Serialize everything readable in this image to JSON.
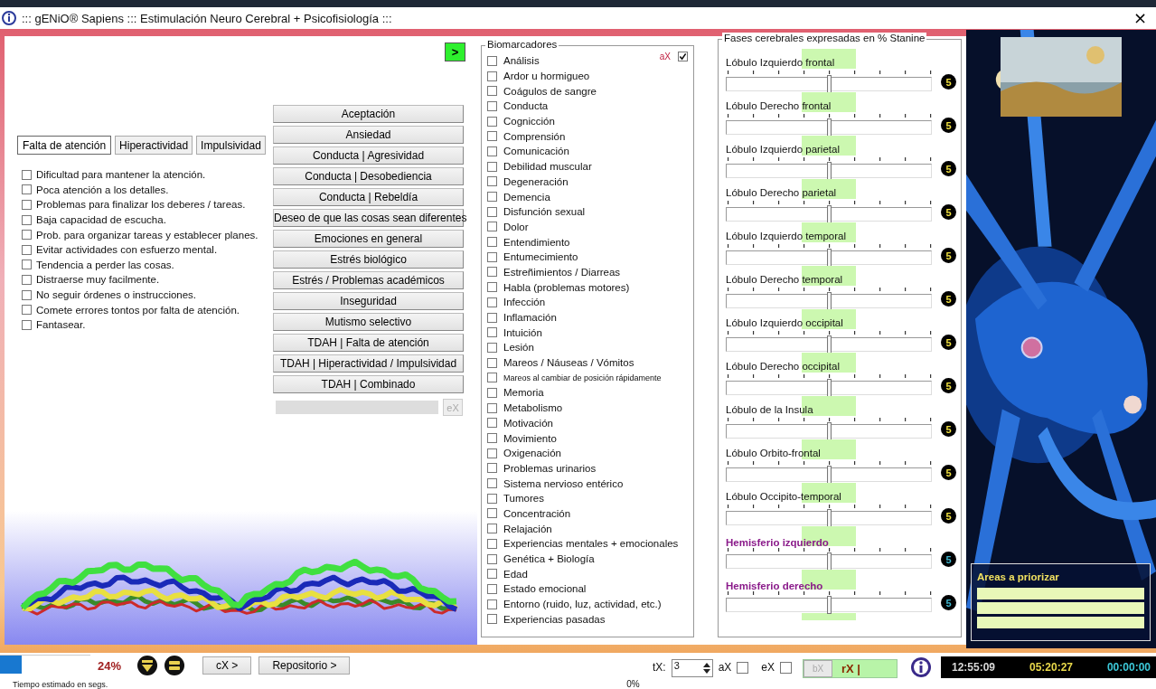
{
  "window": {
    "title": "::: gENiO® Sapiens ::: Estimulación Neuro Cerebral + Psicofisiología :::",
    "close": "×"
  },
  "next_button": ">",
  "tabs": [
    {
      "label": "Falta de atención",
      "selected": true
    },
    {
      "label": "Hiperactividad",
      "selected": false
    },
    {
      "label": "Impulsividad",
      "selected": false
    }
  ],
  "symptoms": [
    {
      "label": "Dificultad para mantener la atención.",
      "checked": false
    },
    {
      "label": "Poca atención a los detalles.",
      "checked": false
    },
    {
      "label": "Problemas para finalizar los deberes / tareas.",
      "checked": false
    },
    {
      "label": "Baja capacidad de escucha.",
      "checked": false
    },
    {
      "label": "Prob. para organizar tareas y establecer planes.",
      "checked": false
    },
    {
      "label": "Evitar actividades con esfuerzo mental.",
      "checked": false
    },
    {
      "label": "Tendencia a perder las cosas.",
      "checked": false
    },
    {
      "label": "Distraerse muy facilmente.",
      "checked": false
    },
    {
      "label": "No seguir órdenes o instrucciones.",
      "checked": false
    },
    {
      "label": "Comete errores tontos por falta de atención.",
      "checked": false
    },
    {
      "label": "Fantasear.",
      "checked": false
    }
  ],
  "protocol_buttons": [
    "Aceptación",
    "Ansiedad",
    "Conducta | Agresividad",
    "Conducta | Desobediencia",
    "Conducta | Rebeldía",
    "Deseo de que las cosas sean diferentes",
    "Emociones en general",
    "Estrés biológico",
    "Estrés / Problemas académicos",
    "Inseguridad",
    "Mutismo selectivo",
    "TDAH | Falta de atención",
    "TDAH | Hiperactividad / Impulsividad",
    "TDAH | Combinado"
  ],
  "ex_button": {
    "label": "eX",
    "disabled": true
  },
  "biomarkers": {
    "title": "Biomarcadores",
    "ax_label": "aX",
    "ax_checked": true,
    "items": [
      {
        "label": "Análisis",
        "kind": "normal",
        "checked": false
      },
      {
        "label": "Ardor u hormigueo",
        "kind": "normal",
        "checked": false
      },
      {
        "label": "Coágulos de sangre",
        "kind": "normal",
        "checked": false
      },
      {
        "label": "Conducta",
        "kind": "normal",
        "checked": false
      },
      {
        "label": "Cognicción",
        "kind": "normal",
        "checked": false
      },
      {
        "label": "Comprensión",
        "kind": "normal",
        "checked": false
      },
      {
        "label": "Comunicación",
        "kind": "normal",
        "checked": false
      },
      {
        "label": "Debilidad muscular",
        "kind": "normal",
        "checked": false
      },
      {
        "label": "Degeneración",
        "kind": "normal",
        "checked": false
      },
      {
        "label": "Demencia",
        "kind": "normal",
        "checked": false
      },
      {
        "label": "Disfunción sexual",
        "kind": "normal",
        "checked": false
      },
      {
        "label": "Dolor",
        "kind": "normal",
        "checked": false
      },
      {
        "label": "Entendimiento",
        "kind": "normal",
        "checked": false
      },
      {
        "label": "Entumecimiento",
        "kind": "normal",
        "checked": false
      },
      {
        "label": "Estreñimientos / Diarreas",
        "kind": "normal",
        "checked": false
      },
      {
        "label": "Habla (problemas motores)",
        "kind": "normal",
        "checked": false
      },
      {
        "label": "Infección",
        "kind": "normal",
        "checked": false
      },
      {
        "label": "Inflamación",
        "kind": "normal",
        "checked": false
      },
      {
        "label": "Intuición",
        "kind": "normal",
        "checked": false
      },
      {
        "label": "Lesión",
        "kind": "normal",
        "checked": false
      },
      {
        "label": "Mareos / Náuseas / Vómitos",
        "kind": "normal",
        "checked": false
      },
      {
        "label": "Mareos al cambiar de posición rápidamente",
        "kind": "small",
        "checked": false
      },
      {
        "label": "Memoria",
        "kind": "normal",
        "checked": false
      },
      {
        "label": "Metabolismo",
        "kind": "normal",
        "checked": false
      },
      {
        "label": "Motivación",
        "kind": "normal",
        "checked": false
      },
      {
        "label": "Movimiento",
        "kind": "normal",
        "checked": false
      },
      {
        "label": "Oxigenación",
        "kind": "normal",
        "checked": false
      },
      {
        "label": "Problemas urinarios",
        "kind": "normal",
        "checked": false
      },
      {
        "label": "Sistema nervioso entérico",
        "kind": "normal",
        "checked": false
      },
      {
        "label": "Tumores",
        "kind": "normal",
        "checked": false
      },
      {
        "label": "Concentración",
        "kind": "normal",
        "checked": false
      },
      {
        "label": "Relajación",
        "kind": "normal",
        "checked": false
      },
      {
        "label": "Experiencias mentales + emocionales",
        "kind": "normal",
        "checked": false
      },
      {
        "label": "Genética + Biología",
        "kind": "normal",
        "checked": false
      },
      {
        "label": "Edad",
        "kind": "normal",
        "checked": false
      },
      {
        "label": "Estado emocional",
        "kind": "normal",
        "checked": false
      },
      {
        "label": "Entorno (ruido, luz, actividad, etc.)",
        "kind": "normal",
        "checked": false
      },
      {
        "label": "Experiencias pasadas",
        "kind": "normal",
        "checked": false
      }
    ]
  },
  "phases": {
    "title": "Fases cerebrales expresadas en % Stanine",
    "sliders": [
      {
        "label": "Lóbulo Izquierdo frontal",
        "kind": "lobe",
        "level": 0.5,
        "value": "5"
      },
      {
        "label": "Lóbulo Derecho frontal",
        "kind": "lobe",
        "level": 0.5,
        "value": "5"
      },
      {
        "label": "Lóbulo Izquierdo parietal",
        "kind": "lobe",
        "level": 0.5,
        "value": "5"
      },
      {
        "label": "Lóbulo Derecho parietal",
        "kind": "lobe",
        "level": 0.5,
        "value": "5"
      },
      {
        "label": "Lóbulo Izquierdo temporal",
        "kind": "lobe",
        "level": 0.5,
        "value": "5"
      },
      {
        "label": "Lóbulo Derecho temporal",
        "kind": "lobe",
        "level": 0.5,
        "value": "5"
      },
      {
        "label": "Lóbulo Izquierdo occipital",
        "kind": "lobe",
        "level": 0.5,
        "value": "5"
      },
      {
        "label": "Lóbulo Derecho occipital",
        "kind": "lobe",
        "level": 0.5,
        "value": "5"
      },
      {
        "label": "Lóbulo de la Insula",
        "kind": "lobe",
        "level": 0.5,
        "value": "5"
      },
      {
        "label": "Lóbulo Orbito-frontal",
        "kind": "lobe",
        "level": 0.5,
        "value": "5"
      },
      {
        "label": "Lóbulo Occipito-temporal",
        "kind": "lobe",
        "level": 0.5,
        "value": "5"
      },
      {
        "label": "Hemisferio izquierdo",
        "kind": "hemisphere",
        "level": 0.5,
        "value": "5"
      },
      {
        "label": "Hemisferio derecho",
        "kind": "hemisphere",
        "level": 0.5,
        "value": "5"
      }
    ]
  },
  "priority_areas": {
    "title": "Areas a priorizar"
  },
  "status_bar": {
    "progress": {
      "level": 0.24,
      "percent": "24%"
    },
    "estimate_label": "Tiempo estimado en segs.",
    "buttons": [
      "cX >",
      "Repositorio >"
    ],
    "zero_percent": "0%",
    "tx_label": "tX:",
    "tx_value": "3",
    "ax": {
      "label": "aX",
      "checked": false
    },
    "ex": {
      "label": "eX",
      "checked": false
    },
    "bx_button": {
      "label": "bX",
      "disabled": true
    },
    "rx_field": "rX |",
    "times": [
      {
        "value": "12:55:09",
        "color": "#d8d8d8"
      },
      {
        "value": "05:20:27",
        "color": "#e8d84a"
      },
      {
        "value": "00:00:00",
        "color": "#3cc8d8"
      }
    ]
  }
}
